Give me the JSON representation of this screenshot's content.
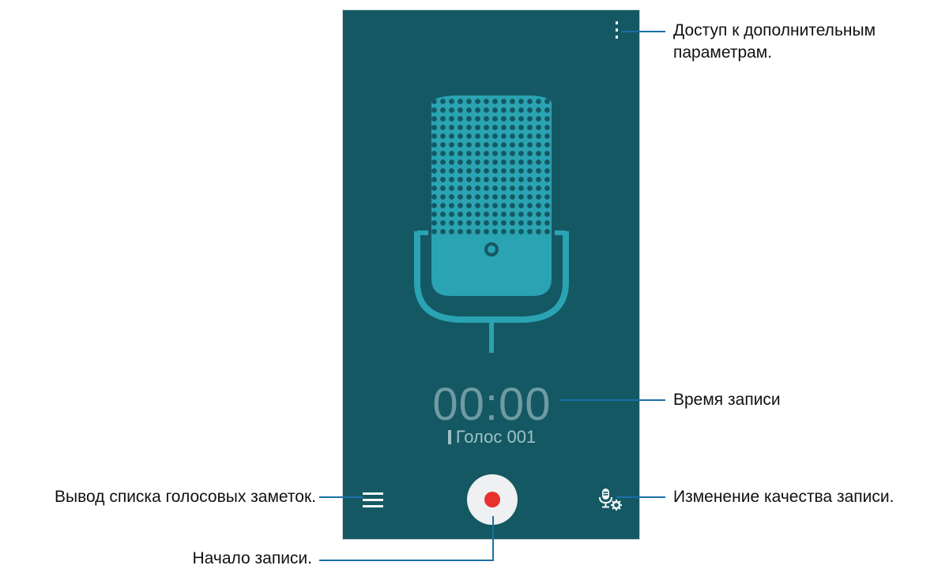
{
  "app": {
    "timer": "00:00",
    "file_name": "Голос 001"
  },
  "icons": {
    "more": "more-vertical-icon",
    "list": "list-icon",
    "record": "record-icon",
    "quality": "mic-settings-icon",
    "mic_art": "microphone-illustration"
  },
  "colors": {
    "screen_bg": "#145863",
    "mic_teal": "#2aa3b2",
    "record_red": "#e8312f"
  },
  "callouts": {
    "more_options": "Доступ к дополнительным параметрам.",
    "recording_time": "Время записи",
    "list_notes": "Вывод списка голосовых заметок.",
    "change_quality": "Изменение качества записи.",
    "start_recording": "Начало записи."
  }
}
